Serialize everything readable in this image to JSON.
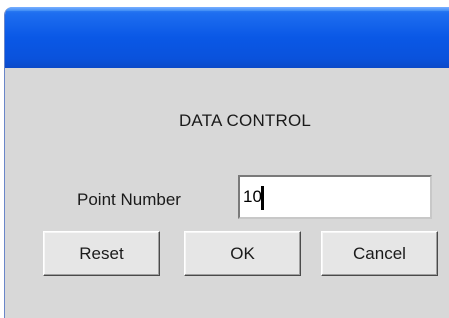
{
  "dialog": {
    "heading": "DATA CONTROL",
    "field": {
      "label": "Point Number",
      "value": "10"
    },
    "buttons": {
      "reset": "Reset",
      "ok": "OK",
      "cancel": "Cancel"
    }
  },
  "colors": {
    "titlebar": "#0a58e6",
    "window_bg": "#d8d8d8",
    "button_bg": "#e6e6e6"
  }
}
